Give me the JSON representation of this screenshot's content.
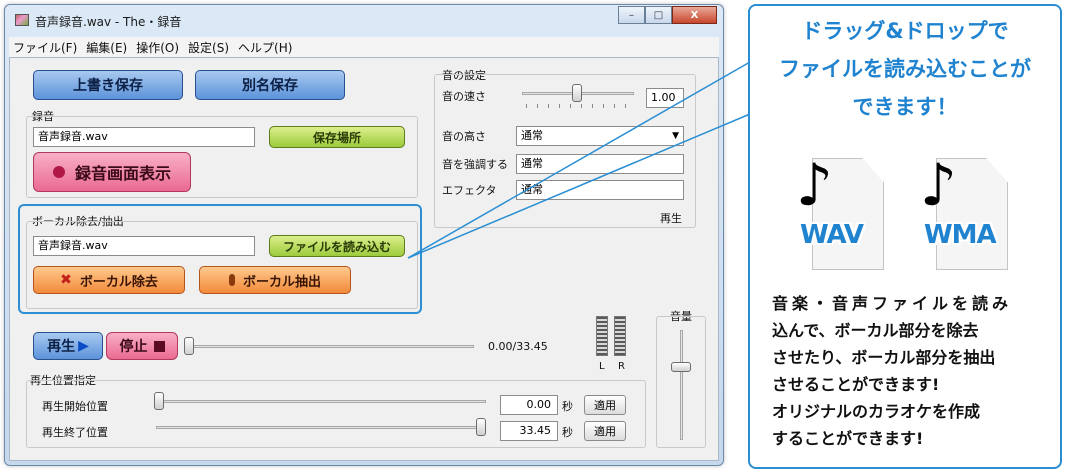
{
  "window": {
    "title": "音声録音.wav - The・録音",
    "controls": {
      "minimize": "–",
      "maximize": "□",
      "close": "X"
    }
  },
  "menu": [
    "ファイル(F)",
    "編集(E)",
    "操作(O)",
    "設定(S)",
    "ヘルプ(H)"
  ],
  "save": {
    "overwrite": "上書き保存",
    "save_as": "別名保存"
  },
  "record": {
    "group_label": "録音",
    "filename": "音声録音.wav",
    "location_button": "保存場所",
    "show_button": "録音画面表示"
  },
  "vocal": {
    "group_label": "ボーカル除去/抽出",
    "filename": "音声録音.wav",
    "load_button": "ファイルを読み込む",
    "remove_button": "ボーカル除去",
    "extract_button": "ボーカル抽出"
  },
  "sound": {
    "group_label": "音の設定",
    "speed_label": "音の速さ",
    "speed_value": "1.00",
    "pitch_label": "音の高さ",
    "pitch_value": "通常",
    "emphasis_label": "音を強調する",
    "emphasis_value": "通常",
    "effect_label": "エフェクタ",
    "effect_value": "通常",
    "partial_text": "再生"
  },
  "playback": {
    "play_button": "再生",
    "stop_button": "停止",
    "time": "0.00/33.45",
    "meter_left": "L",
    "meter_right": "R",
    "volume_label": "音量",
    "position_group": "再生位置指定",
    "start_label": "再生開始位置",
    "start_value": "0.00",
    "end_label": "再生終了位置",
    "end_value": "33.45",
    "unit": "秒",
    "apply": "適用"
  },
  "callout": {
    "headline": [
      "ドラッグ&ドロップで",
      "ファイルを読み込むことが",
      "できます！"
    ],
    "formats": [
      "WAV",
      "WMA"
    ],
    "note_glyph": "♪",
    "body": [
      "音楽・音声ファイルを読み",
      "込んで、ボーカル部分を除去",
      "させたり、ボーカル部分を抽出",
      "させることができます!",
      "オリジナルのカラオケを作成",
      "することができます!"
    ]
  },
  "colors": {
    "accent_blue": "#2a8ed3",
    "headline_blue": "#1f83cf",
    "record_pink": "#ea6a92",
    "vocal_orange": "#f28a3a",
    "button_green": "#9ccb3c"
  }
}
